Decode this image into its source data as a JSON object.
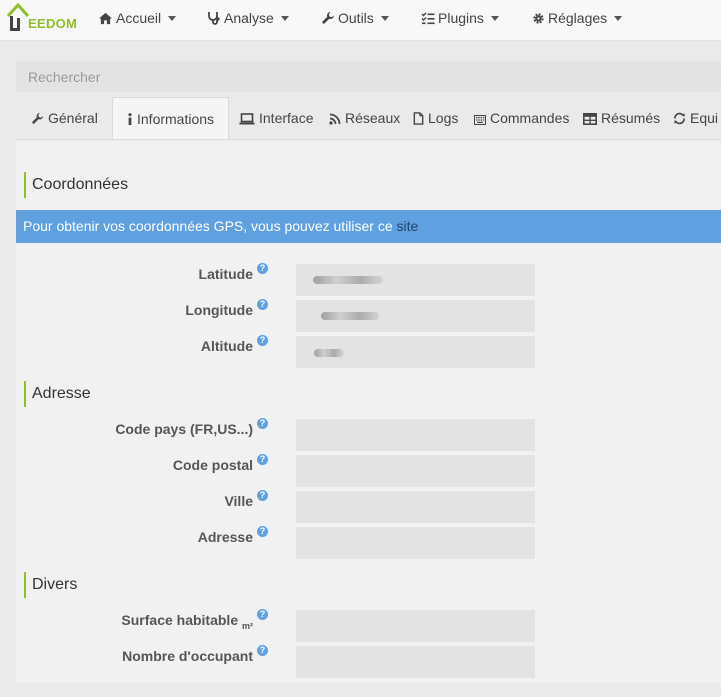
{
  "brand": {
    "name": "EEDOM",
    "accent": "#8fbf2a"
  },
  "nav": {
    "items": [
      {
        "label": "Accueil",
        "icon": "home-icon"
      },
      {
        "label": "Analyse",
        "icon": "stethoscope-icon"
      },
      {
        "label": "Outils",
        "icon": "wrench-icon"
      },
      {
        "label": "Plugins",
        "icon": "tasks-icon"
      },
      {
        "label": "Réglages",
        "icon": "gear-icon"
      }
    ]
  },
  "search": {
    "placeholder": "Rechercher"
  },
  "tabs": [
    {
      "label": "Général",
      "icon": "wrench-icon"
    },
    {
      "label": "Informations",
      "icon": "info-icon",
      "active": true
    },
    {
      "label": "Interface",
      "icon": "laptop-icon"
    },
    {
      "label": "Réseaux",
      "icon": "rss-icon"
    },
    {
      "label": "Logs",
      "icon": "file-icon"
    },
    {
      "label": "Commandes",
      "icon": "keyboard-icon"
    },
    {
      "label": "Résumés",
      "icon": "table-icon"
    },
    {
      "label": "Equi",
      "icon": "sync-icon"
    }
  ],
  "sections": {
    "coords": {
      "title": "Coordonnées",
      "info_text": "Pour obtenir vos coordonnées GPS, vous pouvez utiliser ce ",
      "info_link": "site",
      "fields": [
        {
          "label": "Latitude"
        },
        {
          "label": "Longitude"
        },
        {
          "label": "Altitude"
        }
      ]
    },
    "address": {
      "title": "Adresse",
      "fields": [
        {
          "label": "Code pays (FR,US...)"
        },
        {
          "label": "Code postal"
        },
        {
          "label": "Ville"
        },
        {
          "label": "Adresse"
        }
      ]
    },
    "misc": {
      "title": "Divers",
      "fields": [
        {
          "label": "Surface habitable",
          "unit": "m²"
        },
        {
          "label": "Nombre d'occupant"
        }
      ]
    }
  },
  "help_glyph": "?",
  "info_color": "#5fa0e0"
}
